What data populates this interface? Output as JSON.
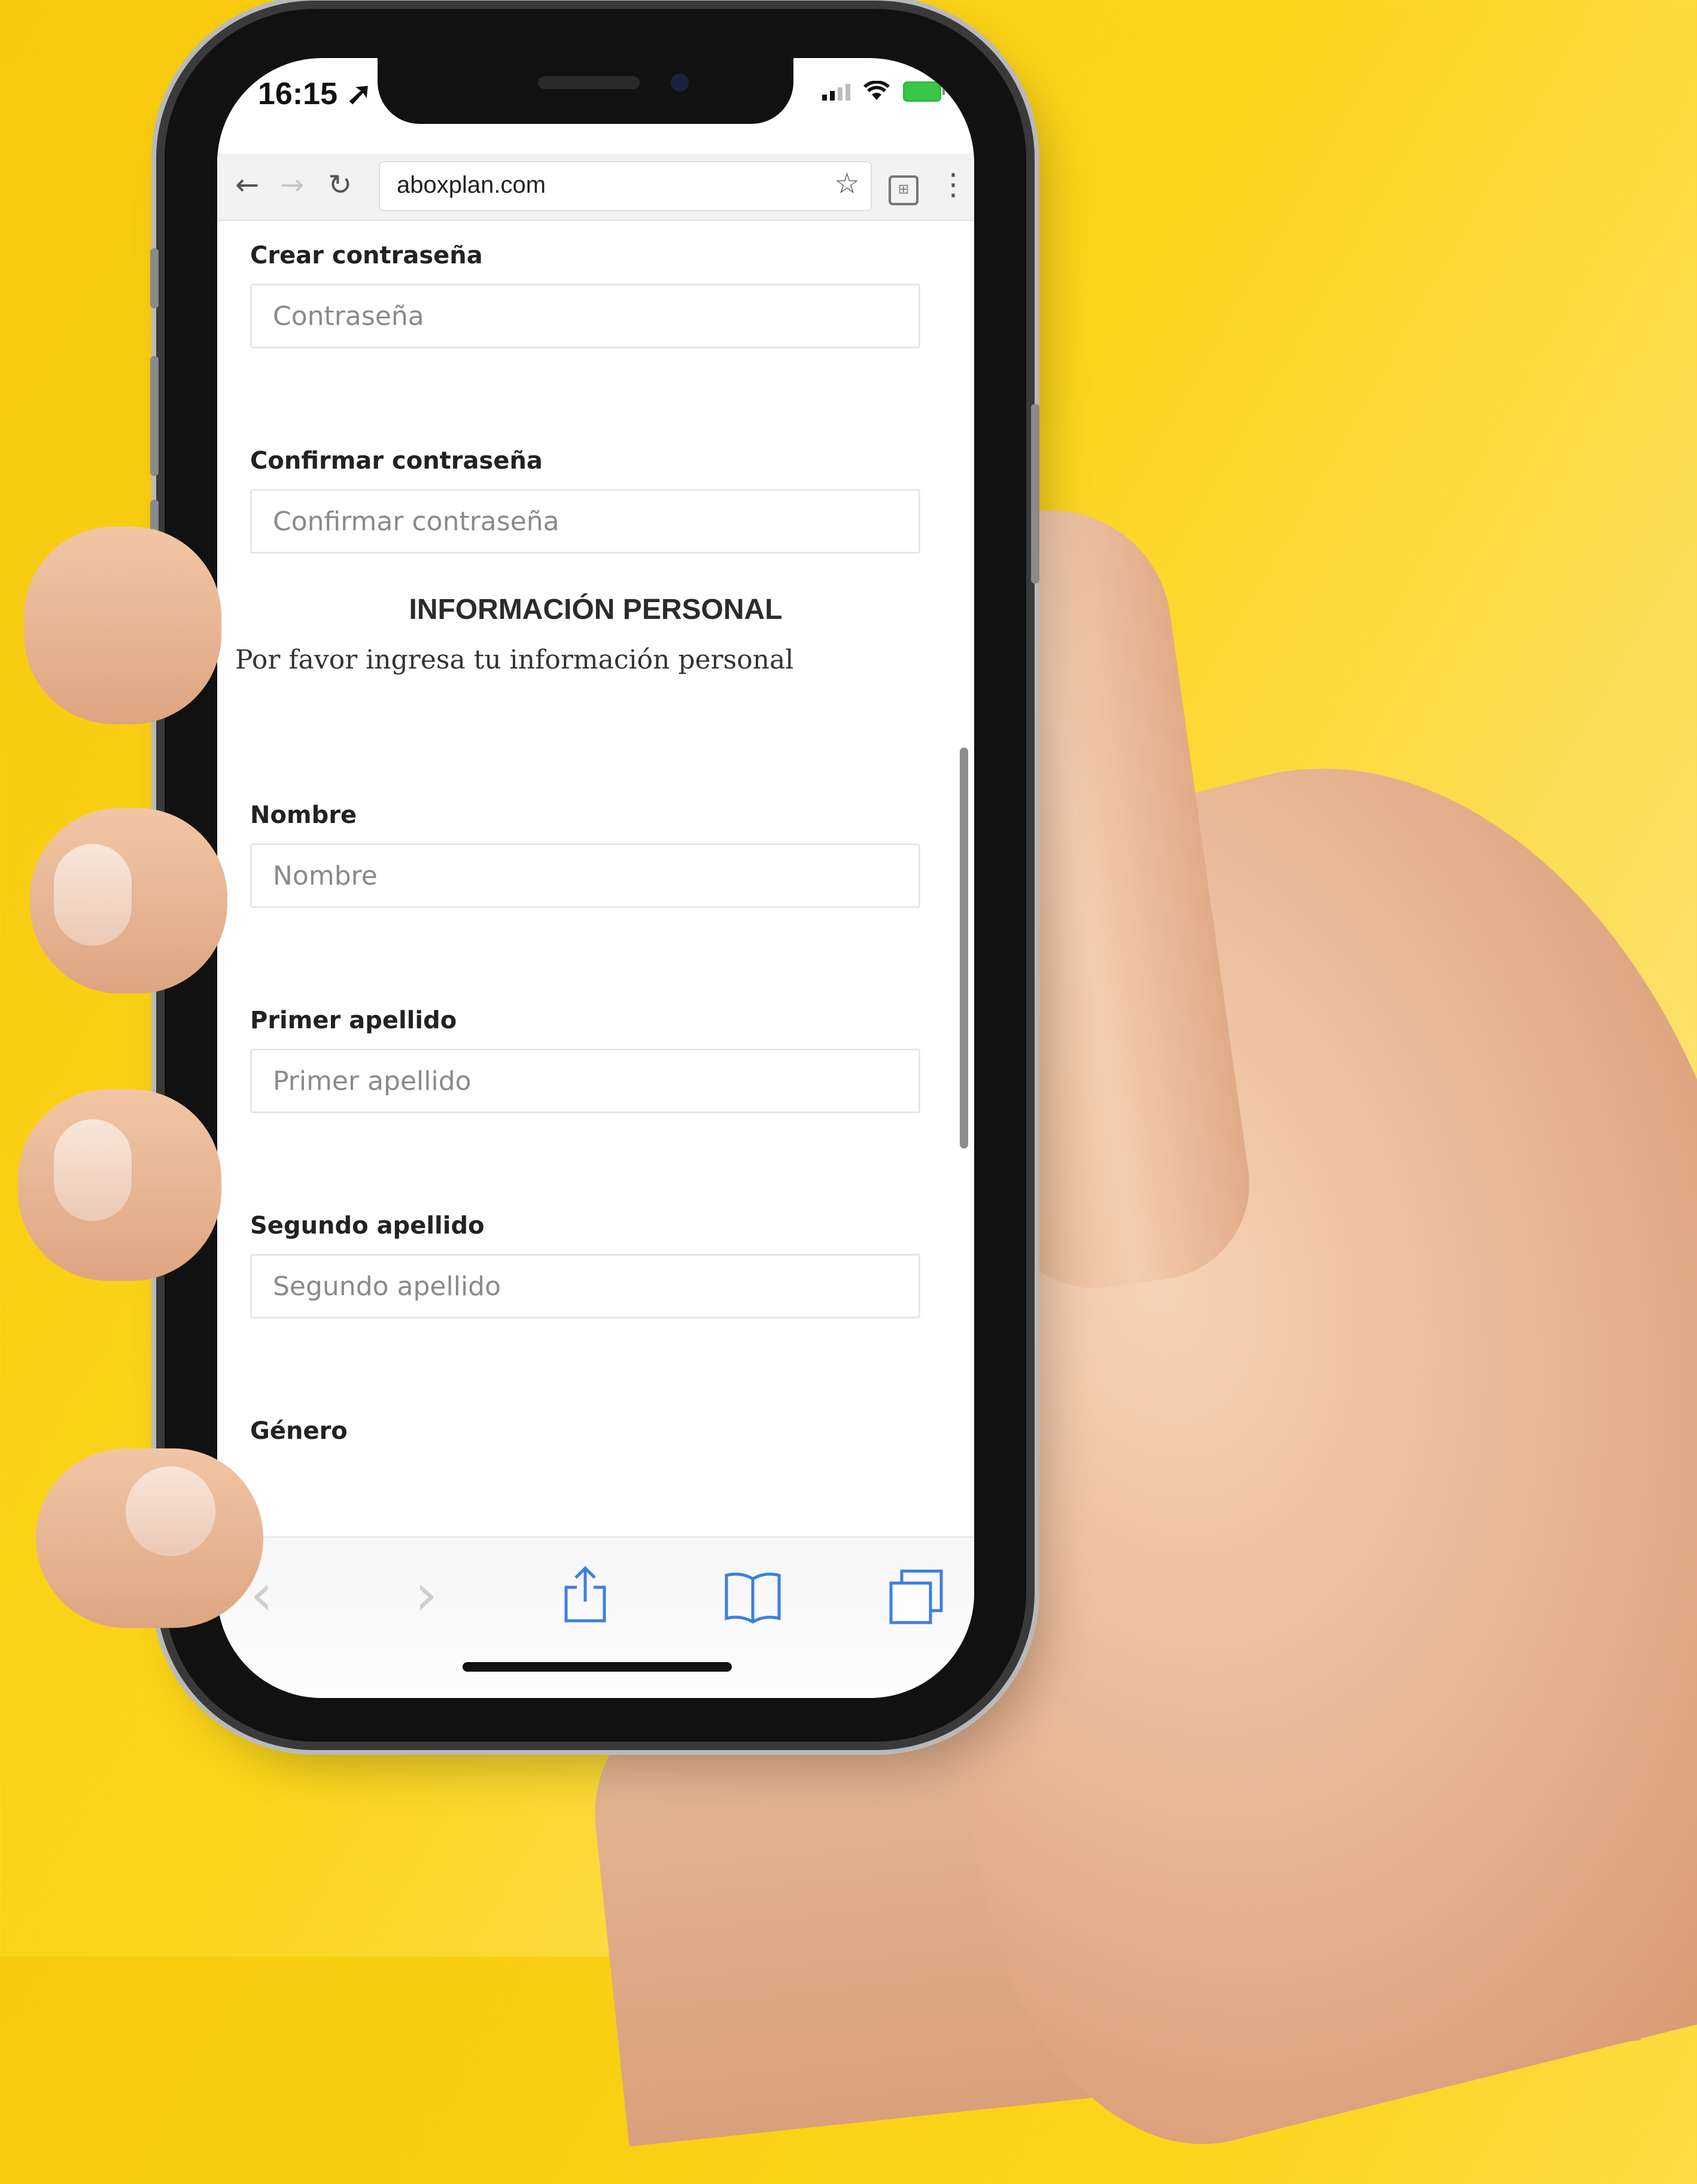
{
  "status_bar": {
    "time": "16:15 ➚"
  },
  "browser": {
    "url": "aboxplan.com"
  },
  "form": {
    "fields_top": [
      {
        "label": "Crear contraseña",
        "placeholder": "Contraseña"
      },
      {
        "label": "Confirmar contraseña",
        "placeholder": "Confirmar contraseña"
      }
    ],
    "section_title": "INFORMACIÓN PERSONAL",
    "section_description": "Por favor ingresa tu información personal",
    "fields_personal": [
      {
        "label": "Nombre",
        "placeholder": "Nombre"
      },
      {
        "label": "Primer apellido",
        "placeholder": "Primer apellido"
      },
      {
        "label": "Segundo apellido",
        "placeholder": "Segundo apellido"
      }
    ],
    "gender_label": "Género"
  },
  "colors": {
    "background": "#f9cf14",
    "toolbar_icon_active": "#3d7fe0"
  }
}
